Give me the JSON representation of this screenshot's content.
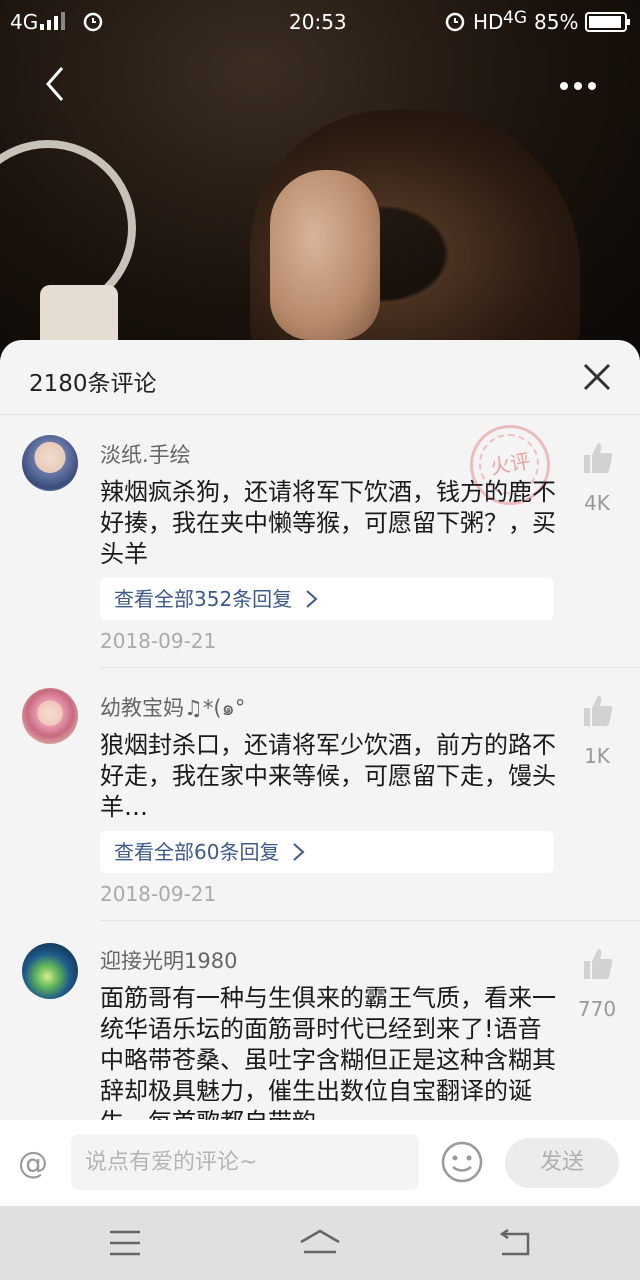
{
  "status_bar": {
    "network": "4G",
    "time": "20:53",
    "hd": "HD",
    "net2": "4G",
    "battery": "85%"
  },
  "nav": {
    "back_icon": "chevron-left-icon",
    "more_icon": "more-horizontal-icon"
  },
  "comments_panel": {
    "title": "2180条评论",
    "comments": [
      {
        "user": "淡纸.手绘",
        "text": "辣烟疯杀狗，还请将军下饮酒，钱方的鹿不好揍，我在夹中懒等猴，可愿留下粥？，买头羊",
        "replies": "查看全部352条回复",
        "date": "2018-09-21",
        "likes": "4K",
        "stamp_text": "火评"
      },
      {
        "user": "幼教宝妈♫*(๑°",
        "text": "狼烟封杀口，还请将军少饮酒，前方的路不好走，我在家中来等候，可愿留下走，馒头羊…",
        "replies": "查看全部60条回复",
        "date": "2018-09-21",
        "likes": "1K"
      },
      {
        "user": "迎接光明1980",
        "text": "面筋哥有一种与生俱来的霸王气质，看来一统华语乐坛的面筋哥时代已经到来了!语音中略带苍桑、虽吐字含糊但正是这种含糊其辞却极具魅力，催生出数位自宝翻译的诞生，每首歌都自带韵",
        "likes": "770"
      }
    ]
  },
  "input_bar": {
    "at_symbol": "@",
    "placeholder": "说点有爱的评论~",
    "send_label": "发送"
  }
}
